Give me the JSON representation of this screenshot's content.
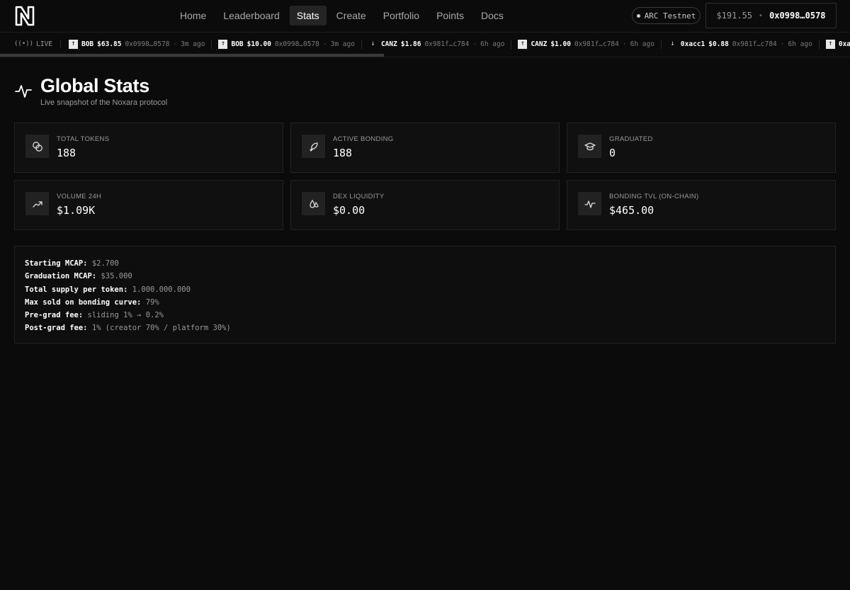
{
  "nav": {
    "items": [
      {
        "label": "Home",
        "active": false
      },
      {
        "label": "Leaderboard",
        "active": false
      },
      {
        "label": "Stats",
        "active": true
      },
      {
        "label": "Create",
        "active": false
      },
      {
        "label": "Portfolio",
        "active": false
      },
      {
        "label": "Points",
        "active": false
      },
      {
        "label": "Docs",
        "active": false
      }
    ],
    "network": "ARC Testnet",
    "wallet": {
      "balance": "$191.55",
      "separator": "•",
      "address": "0x0998…0578"
    }
  },
  "ticker": {
    "live_label": "LIVE",
    "trades": [
      {
        "direction": "up",
        "symbol": "BOB",
        "price": "$63.85",
        "address": "0x0998…0578",
        "ago": "3m ago"
      },
      {
        "direction": "up",
        "symbol": "BOB",
        "price": "$10.00",
        "address": "0x0998…0578",
        "ago": "3m ago"
      },
      {
        "direction": "down",
        "symbol": "CANZ",
        "price": "$1.86",
        "address": "0x981f…c784",
        "ago": "6h ago"
      },
      {
        "direction": "up",
        "symbol": "CANZ",
        "price": "$1.00",
        "address": "0x981f…c784",
        "ago": "6h ago"
      },
      {
        "direction": "down",
        "symbol": "0xacc1",
        "price": "$0.88",
        "address": "0x981f…c784",
        "ago": "6h ago"
      },
      {
        "direction": "up",
        "symbol": "0xa",
        "price": "",
        "address": "",
        "ago": ""
      }
    ]
  },
  "page": {
    "title": "Global Stats",
    "subtitle": "Live snapshot of the Noxara protocol"
  },
  "stats": [
    {
      "label": "TOTAL TOKENS",
      "value": "188",
      "icon": "coins-icon"
    },
    {
      "label": "ACTIVE BONDING",
      "value": "188",
      "icon": "rocket-icon"
    },
    {
      "label": "GRADUATED",
      "value": "0",
      "icon": "graduation-cap-icon"
    },
    {
      "label": "VOLUME 24H",
      "value": "$1.09K",
      "icon": "trending-up-icon"
    },
    {
      "label": "DEX LIQUIDITY",
      "value": "$0.00",
      "icon": "droplets-icon"
    },
    {
      "label": "BONDING TVL (ON-CHAIN)",
      "value": "$465.00",
      "icon": "activity-icon"
    }
  ],
  "params": [
    {
      "key": "Starting MCAP:",
      "value": "$2.700"
    },
    {
      "key": "Graduation MCAP:",
      "value": "$35.000"
    },
    {
      "key": "Total supply per token:",
      "value": "1.000.000.000"
    },
    {
      "key": "Max sold on bonding curve:",
      "value": "79%"
    },
    {
      "key": "Pre-grad fee:",
      "value": "sliding 1% → 0.2%"
    },
    {
      "key": "Post-grad fee:",
      "value": "1% (creator 70% / platform 30%)"
    }
  ]
}
